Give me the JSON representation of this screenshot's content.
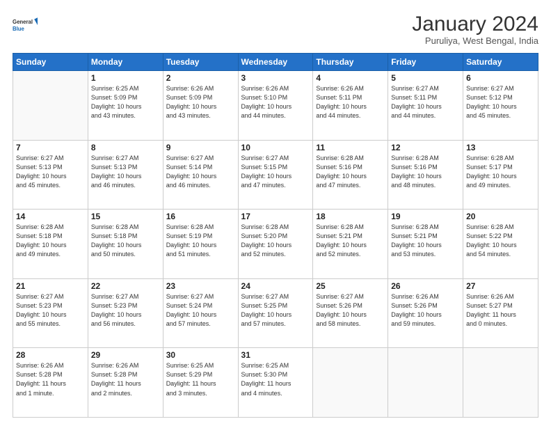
{
  "logo": {
    "general": "General",
    "blue": "Blue"
  },
  "header": {
    "month_year": "January 2024",
    "location": "Puruliya, West Bengal, India"
  },
  "days_of_week": [
    "Sunday",
    "Monday",
    "Tuesday",
    "Wednesday",
    "Thursday",
    "Friday",
    "Saturday"
  ],
  "weeks": [
    [
      {
        "day": "",
        "info": ""
      },
      {
        "day": "1",
        "info": "Sunrise: 6:25 AM\nSunset: 5:09 PM\nDaylight: 10 hours\nand 43 minutes."
      },
      {
        "day": "2",
        "info": "Sunrise: 6:26 AM\nSunset: 5:09 PM\nDaylight: 10 hours\nand 43 minutes."
      },
      {
        "day": "3",
        "info": "Sunrise: 6:26 AM\nSunset: 5:10 PM\nDaylight: 10 hours\nand 44 minutes."
      },
      {
        "day": "4",
        "info": "Sunrise: 6:26 AM\nSunset: 5:11 PM\nDaylight: 10 hours\nand 44 minutes."
      },
      {
        "day": "5",
        "info": "Sunrise: 6:27 AM\nSunset: 5:11 PM\nDaylight: 10 hours\nand 44 minutes."
      },
      {
        "day": "6",
        "info": "Sunrise: 6:27 AM\nSunset: 5:12 PM\nDaylight: 10 hours\nand 45 minutes."
      }
    ],
    [
      {
        "day": "7",
        "info": "Sunrise: 6:27 AM\nSunset: 5:13 PM\nDaylight: 10 hours\nand 45 minutes."
      },
      {
        "day": "8",
        "info": "Sunrise: 6:27 AM\nSunset: 5:13 PM\nDaylight: 10 hours\nand 46 minutes."
      },
      {
        "day": "9",
        "info": "Sunrise: 6:27 AM\nSunset: 5:14 PM\nDaylight: 10 hours\nand 46 minutes."
      },
      {
        "day": "10",
        "info": "Sunrise: 6:27 AM\nSunset: 5:15 PM\nDaylight: 10 hours\nand 47 minutes."
      },
      {
        "day": "11",
        "info": "Sunrise: 6:28 AM\nSunset: 5:16 PM\nDaylight: 10 hours\nand 47 minutes."
      },
      {
        "day": "12",
        "info": "Sunrise: 6:28 AM\nSunset: 5:16 PM\nDaylight: 10 hours\nand 48 minutes."
      },
      {
        "day": "13",
        "info": "Sunrise: 6:28 AM\nSunset: 5:17 PM\nDaylight: 10 hours\nand 49 minutes."
      }
    ],
    [
      {
        "day": "14",
        "info": "Sunrise: 6:28 AM\nSunset: 5:18 PM\nDaylight: 10 hours\nand 49 minutes."
      },
      {
        "day": "15",
        "info": "Sunrise: 6:28 AM\nSunset: 5:18 PM\nDaylight: 10 hours\nand 50 minutes."
      },
      {
        "day": "16",
        "info": "Sunrise: 6:28 AM\nSunset: 5:19 PM\nDaylight: 10 hours\nand 51 minutes."
      },
      {
        "day": "17",
        "info": "Sunrise: 6:28 AM\nSunset: 5:20 PM\nDaylight: 10 hours\nand 52 minutes."
      },
      {
        "day": "18",
        "info": "Sunrise: 6:28 AM\nSunset: 5:21 PM\nDaylight: 10 hours\nand 52 minutes."
      },
      {
        "day": "19",
        "info": "Sunrise: 6:28 AM\nSunset: 5:21 PM\nDaylight: 10 hours\nand 53 minutes."
      },
      {
        "day": "20",
        "info": "Sunrise: 6:28 AM\nSunset: 5:22 PM\nDaylight: 10 hours\nand 54 minutes."
      }
    ],
    [
      {
        "day": "21",
        "info": "Sunrise: 6:27 AM\nSunset: 5:23 PM\nDaylight: 10 hours\nand 55 minutes."
      },
      {
        "day": "22",
        "info": "Sunrise: 6:27 AM\nSunset: 5:23 PM\nDaylight: 10 hours\nand 56 minutes."
      },
      {
        "day": "23",
        "info": "Sunrise: 6:27 AM\nSunset: 5:24 PM\nDaylight: 10 hours\nand 57 minutes."
      },
      {
        "day": "24",
        "info": "Sunrise: 6:27 AM\nSunset: 5:25 PM\nDaylight: 10 hours\nand 57 minutes."
      },
      {
        "day": "25",
        "info": "Sunrise: 6:27 AM\nSunset: 5:26 PM\nDaylight: 10 hours\nand 58 minutes."
      },
      {
        "day": "26",
        "info": "Sunrise: 6:26 AM\nSunset: 5:26 PM\nDaylight: 10 hours\nand 59 minutes."
      },
      {
        "day": "27",
        "info": "Sunrise: 6:26 AM\nSunset: 5:27 PM\nDaylight: 11 hours\nand 0 minutes."
      }
    ],
    [
      {
        "day": "28",
        "info": "Sunrise: 6:26 AM\nSunset: 5:28 PM\nDaylight: 11 hours\nand 1 minute."
      },
      {
        "day": "29",
        "info": "Sunrise: 6:26 AM\nSunset: 5:28 PM\nDaylight: 11 hours\nand 2 minutes."
      },
      {
        "day": "30",
        "info": "Sunrise: 6:25 AM\nSunset: 5:29 PM\nDaylight: 11 hours\nand 3 minutes."
      },
      {
        "day": "31",
        "info": "Sunrise: 6:25 AM\nSunset: 5:30 PM\nDaylight: 11 hours\nand 4 minutes."
      },
      {
        "day": "",
        "info": ""
      },
      {
        "day": "",
        "info": ""
      },
      {
        "day": "",
        "info": ""
      }
    ]
  ]
}
